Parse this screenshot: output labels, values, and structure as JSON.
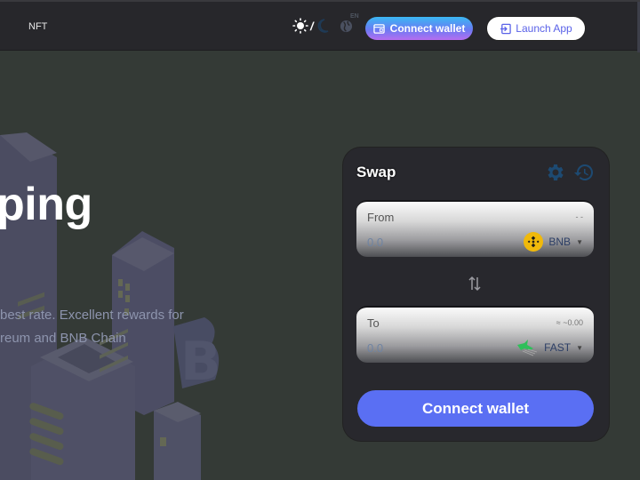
{
  "header": {
    "nav_nft": "NFT",
    "theme_separator": "/",
    "language": "EN",
    "connect_wallet_label": "Connect wallet",
    "launch_app_label": "Launch App"
  },
  "hero": {
    "title": "ping",
    "subtitle_line1": "best rate. Excellent rewards for",
    "subtitle_line2": "reum and BNB Chain"
  },
  "swap": {
    "title": "Swap",
    "from": {
      "label": "From",
      "balance": "- -",
      "amount": "0.0",
      "token": "BNB"
    },
    "to": {
      "label": "To",
      "balance": "≈ ~0.00",
      "amount": "0.0",
      "token": "FAST"
    },
    "connect_wallet_label": "Connect wallet"
  },
  "colors": {
    "accent": "#5a6ff3",
    "header_bg": "#27272b",
    "page_bg": "#343a36",
    "card_bg": "#28282d",
    "bnb_yellow": "#f0b90b",
    "fast_green": "#2fbf5a"
  }
}
